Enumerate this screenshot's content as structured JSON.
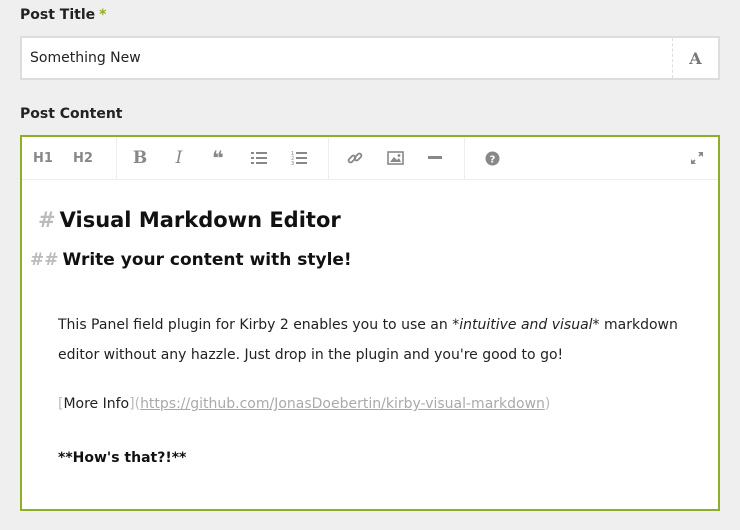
{
  "title_field": {
    "label": "Post Title",
    "required_mark": "*",
    "value": "Something New",
    "font_icon_glyph": "A"
  },
  "content_field": {
    "label": "Post Content",
    "toolbar": {
      "h1_label": "H1",
      "h2_label": "H2",
      "bold_label": "B",
      "italic_label": "I",
      "quote_label": "❝",
      "icons": [
        "bold-icon",
        "italic-icon",
        "quote-icon",
        "unordered-list-icon",
        "ordered-list-icon",
        "link-icon",
        "image-icon",
        "horizontal-rule-icon",
        "help-icon",
        "fullscreen-icon"
      ]
    },
    "body": {
      "h1_hash": "#",
      "h1_text": "Visual Markdown Editor",
      "h2_hash": "##",
      "h2_text": "Write your content with style!",
      "para_before": "This Panel field plugin for Kirby 2 enables you to use an ",
      "para_em": "*intuitive and visual*",
      "para_after": " markdown editor without any hazzle. Just drop in the plugin and you're good to go!",
      "link_open": "[",
      "link_text": "More Info",
      "link_close": "](",
      "link_url": "https://github.com/JonasDoebertin/kirby-visual-markdown",
      "link_end": ")",
      "bold_line": "**How's that?!**"
    }
  },
  "colors": {
    "accent": "#8dae28",
    "background": "#efefef",
    "muted": "#aaaaaa"
  }
}
